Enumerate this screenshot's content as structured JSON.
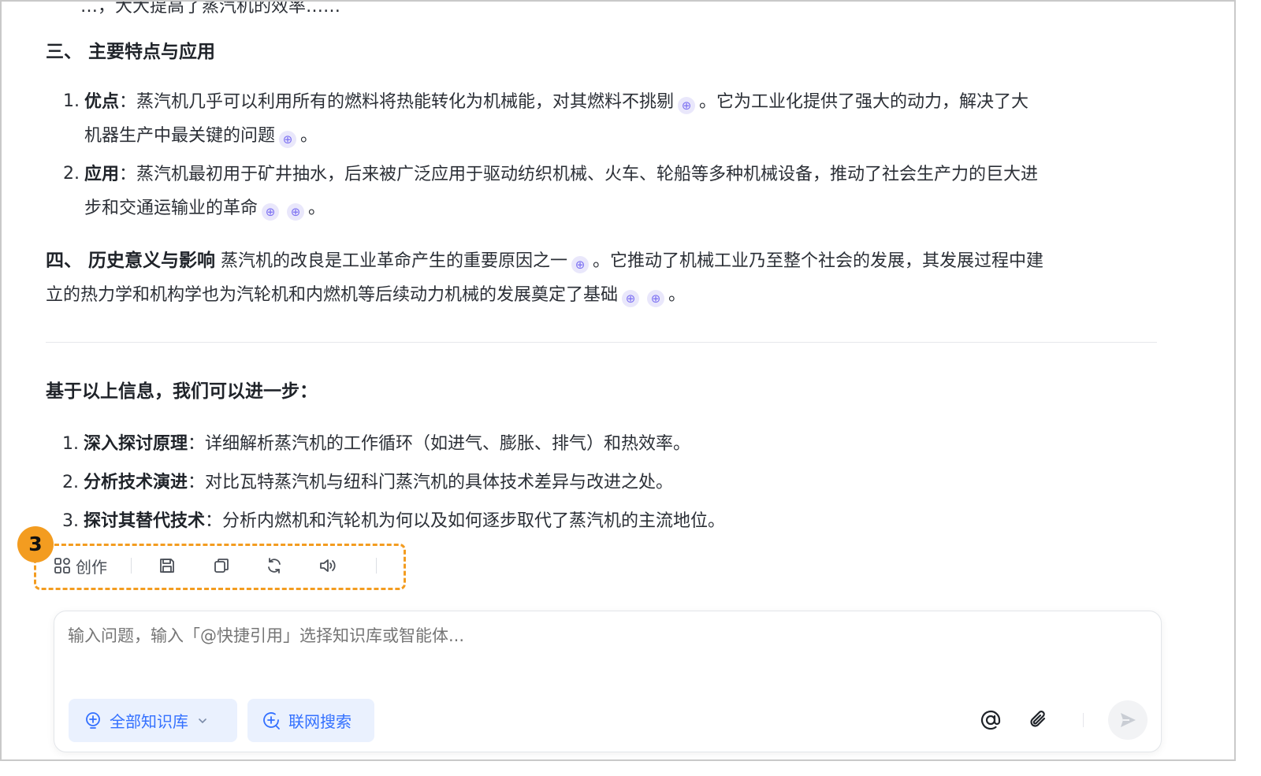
{
  "cut_line": "…，大大提高了蒸汽机的效率……",
  "section3": {
    "title": "三、 主要特点与应用",
    "items": [
      {
        "num": "1.",
        "label": "优点",
        "text_a": "：蒸汽机几乎可以利用所有的燃料将热能转化为机械能，对其燃料不挑剔",
        "text_b": "。它为工业化提供了强大的动力，解决了大",
        "line2": "机器生产中最关键的问题",
        "end": "。"
      },
      {
        "num": "2.",
        "label": "应用",
        "text_a": "：蒸汽机最初用于矿井抽水，后来被广泛应用于驱动纺织机械、火车、轮船等多种机械设备，推动了社会生产力的巨大进",
        "line2": "步和交通运输业的革命",
        "end": "。"
      }
    ]
  },
  "section4": {
    "title": "四、 历史意义与影响",
    "text_a": " 蒸汽机的改良是工业革命产生的重要原因之一",
    "text_b": "。它推动了机械工业乃至整个社会的发展，其发展过程中建",
    "line2": "立的热力学和机构学也为汽轮机和内燃机等后续动力机械的发展奠定了基础",
    "end": "。"
  },
  "next_steps": {
    "title": "基于以上信息，我们可以进一步：",
    "items": [
      {
        "num": "1.",
        "label": "深入探讨原理",
        "text": "：详细解析蒸汽机的工作循环（如进气、膨胀、排气）和热效率。"
      },
      {
        "num": "2.",
        "label": "分析技术演进",
        "text": "：对比瓦特蒸汽机与纽科门蒸汽机的具体技术差异与改进之处。"
      },
      {
        "num": "3.",
        "label": "探讨其替代技术",
        "text": "：分析内燃机和汽轮机为何以及如何逐步取代了蒸汽机的主流地位。"
      }
    ]
  },
  "annotation": {
    "badge": "3",
    "color": "#f39c20"
  },
  "toolbar": {
    "create_label": "创作",
    "icons": [
      "create-icon",
      "save-icon",
      "copy-icon",
      "regenerate-icon",
      "speaker-icon"
    ]
  },
  "input": {
    "placeholder": "输入问题，输入「@快捷引用」选择知识库或智能体...",
    "knowledge_chip": "全部知识库",
    "search_chip": "联网搜索",
    "accent": "#3370ff"
  }
}
